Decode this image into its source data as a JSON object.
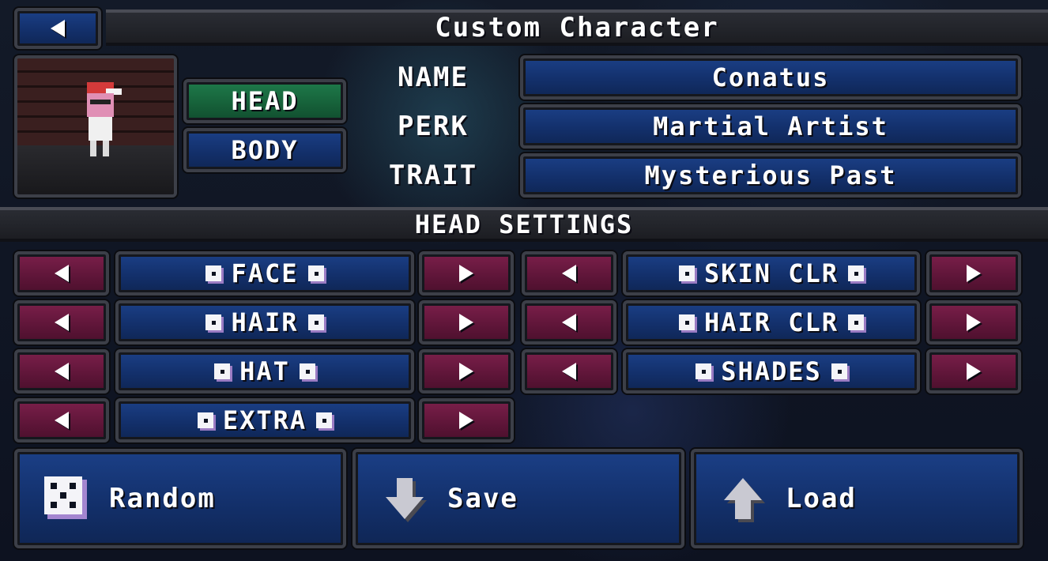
{
  "header": {
    "title": "Custom Character",
    "back_icon": "back-arrow-icon"
  },
  "tabs": [
    {
      "label": "HEAD",
      "active": true
    },
    {
      "label": "BODY",
      "active": false
    }
  ],
  "info": {
    "name_label": "NAME",
    "name_value": "Conatus",
    "perk_label": "PERK",
    "perk_value": "Martial Artist",
    "trait_label": "TRAIT",
    "trait_value": "Mysterious Past"
  },
  "section_title": "HEAD SETTINGS",
  "settings_left": [
    {
      "label": "FACE"
    },
    {
      "label": "HAIR"
    },
    {
      "label": "HAT"
    },
    {
      "label": "EXTRA"
    }
  ],
  "settings_right": [
    {
      "label": "SKIN CLR"
    },
    {
      "label": "HAIR CLR"
    },
    {
      "label": "SHADES"
    }
  ],
  "actions": {
    "random_label": "Random",
    "save_label": "Save",
    "load_label": "Load"
  },
  "colors": {
    "button_blue": "#1b3f86",
    "arrow_maroon": "#7a1f4a",
    "active_green": "#1e7a4a",
    "frame_gray": "#3c3f48"
  }
}
